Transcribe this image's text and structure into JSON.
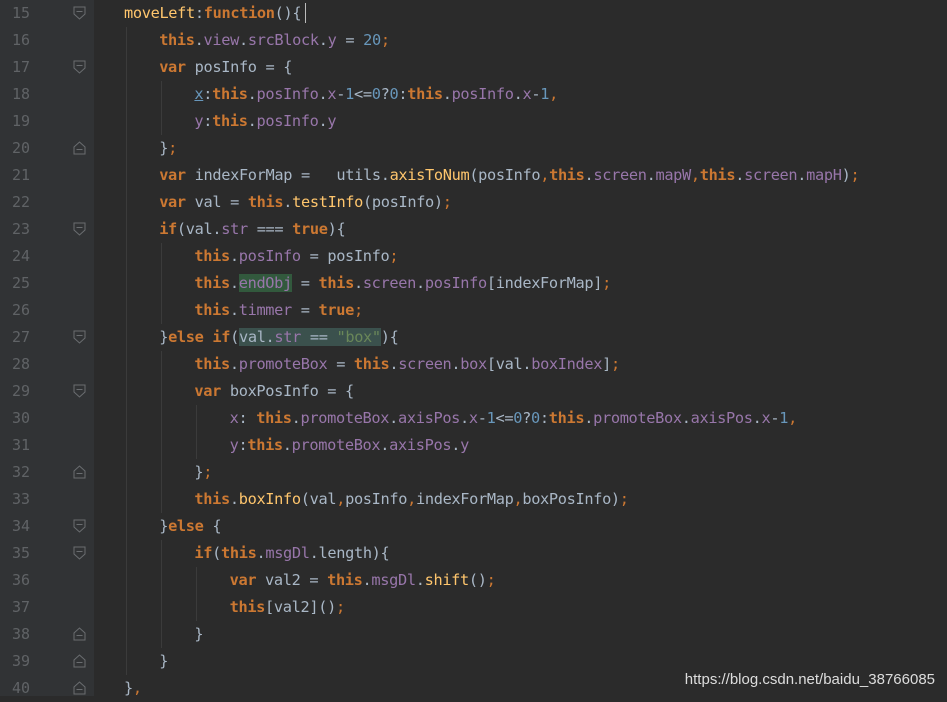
{
  "editor": {
    "watermark": "https://blog.csdn.net/baidu_38766085",
    "lines": [
      {
        "num": "15",
        "tokens": [
          [
            "fn",
            "moveLeft"
          ],
          [
            "plain",
            ":"
          ],
          [
            "kw",
            "function"
          ],
          [
            "plain",
            "()"
          ],
          [
            "plain",
            "{"
          ]
        ]
      },
      {
        "num": "16",
        "tokens": [
          [
            "kw",
            "this"
          ],
          [
            "plain",
            "."
          ],
          [
            "prop",
            "view"
          ],
          [
            "plain",
            "."
          ],
          [
            "prop",
            "srcBlock"
          ],
          [
            "plain",
            "."
          ],
          [
            "prop",
            "y"
          ],
          [
            "plain",
            " = "
          ],
          [
            "num",
            "20"
          ],
          [
            "punct",
            ";"
          ]
        ]
      },
      {
        "num": "17",
        "tokens": [
          [
            "kw",
            "var"
          ],
          [
            "plain",
            " posInfo = {"
          ]
        ]
      },
      {
        "num": "18",
        "tokens": [
          [
            "u",
            "x"
          ],
          [
            "plain",
            ":"
          ],
          [
            "kw",
            "this"
          ],
          [
            "plain",
            "."
          ],
          [
            "prop",
            "posInfo"
          ],
          [
            "plain",
            "."
          ],
          [
            "prop",
            "x"
          ],
          [
            "plain",
            "-"
          ],
          [
            "num",
            "1"
          ],
          [
            "plain",
            "<="
          ],
          [
            "num",
            "0"
          ],
          [
            "plain",
            "?"
          ],
          [
            "num",
            "0"
          ],
          [
            "plain",
            ":"
          ],
          [
            "kw",
            "this"
          ],
          [
            "plain",
            "."
          ],
          [
            "prop",
            "posInfo"
          ],
          [
            "plain",
            "."
          ],
          [
            "prop",
            "x"
          ],
          [
            "plain",
            "-"
          ],
          [
            "num",
            "1"
          ],
          [
            "punct",
            ","
          ]
        ]
      },
      {
        "num": "19",
        "tokens": [
          [
            "prop",
            "y"
          ],
          [
            "plain",
            ":"
          ],
          [
            "kw",
            "this"
          ],
          [
            "plain",
            "."
          ],
          [
            "prop",
            "posInfo"
          ],
          [
            "plain",
            "."
          ],
          [
            "prop",
            "y"
          ]
        ]
      },
      {
        "num": "20",
        "tokens": [
          [
            "plain",
            "}"
          ],
          [
            "punct",
            ";"
          ]
        ]
      },
      {
        "num": "21",
        "tokens": [
          [
            "kw",
            "var"
          ],
          [
            "plain",
            " indexForMap =   utils."
          ],
          [
            "fn",
            "axisToNum"
          ],
          [
            "plain",
            "(posInfo"
          ],
          [
            "punct",
            ","
          ],
          [
            "kw",
            "this"
          ],
          [
            "plain",
            "."
          ],
          [
            "prop",
            "screen"
          ],
          [
            "plain",
            "."
          ],
          [
            "prop",
            "mapW"
          ],
          [
            "punct",
            ","
          ],
          [
            "kw",
            "this"
          ],
          [
            "plain",
            "."
          ],
          [
            "prop",
            "screen"
          ],
          [
            "plain",
            "."
          ],
          [
            "prop",
            "mapH"
          ],
          [
            "plain",
            ")"
          ],
          [
            "punct",
            ";"
          ]
        ]
      },
      {
        "num": "22",
        "tokens": [
          [
            "kw",
            "var"
          ],
          [
            "plain",
            " val = "
          ],
          [
            "kw",
            "this"
          ],
          [
            "plain",
            "."
          ],
          [
            "fn",
            "testInfo"
          ],
          [
            "plain",
            "(posInfo)"
          ],
          [
            "punct",
            ";"
          ]
        ]
      },
      {
        "num": "23",
        "tokens": [
          [
            "kw",
            "if"
          ],
          [
            "plain",
            "(val."
          ],
          [
            "prop",
            "str"
          ],
          [
            "plain",
            " === "
          ],
          [
            "kw",
            "true"
          ],
          [
            "plain",
            "){"
          ]
        ]
      },
      {
        "num": "24",
        "tokens": [
          [
            "kw",
            "this"
          ],
          [
            "plain",
            "."
          ],
          [
            "prop",
            "posInfo"
          ],
          [
            "plain",
            " = posInfo"
          ],
          [
            "punct",
            ";"
          ]
        ]
      },
      {
        "num": "25",
        "tokens": [
          [
            "kw",
            "this"
          ],
          [
            "plain",
            "."
          ],
          [
            "hl",
            "endObj"
          ],
          [
            "plain",
            " = "
          ],
          [
            "kw",
            "this"
          ],
          [
            "plain",
            "."
          ],
          [
            "prop",
            "screen"
          ],
          [
            "plain",
            "."
          ],
          [
            "prop",
            "posInfo"
          ],
          [
            "plain",
            "[indexForMap]"
          ],
          [
            "punct",
            ";"
          ]
        ]
      },
      {
        "num": "26",
        "tokens": [
          [
            "kw",
            "this"
          ],
          [
            "plain",
            "."
          ],
          [
            "prop",
            "timmer"
          ],
          [
            "plain",
            " = "
          ],
          [
            "kw",
            "true"
          ],
          [
            "punct",
            ";"
          ]
        ]
      },
      {
        "num": "27",
        "tokens": [
          [
            "plain",
            "}"
          ],
          [
            "kw",
            "else if"
          ],
          [
            "plain",
            "("
          ],
          [
            "m1",
            "val."
          ],
          [
            "m2",
            "str"
          ],
          [
            "m1",
            " == "
          ],
          [
            "m3",
            "\"box\""
          ],
          [
            "plain",
            "){"
          ]
        ]
      },
      {
        "num": "28",
        "tokens": [
          [
            "kw",
            "this"
          ],
          [
            "plain",
            "."
          ],
          [
            "prop",
            "promoteBox"
          ],
          [
            "plain",
            " = "
          ],
          [
            "kw",
            "this"
          ],
          [
            "plain",
            "."
          ],
          [
            "prop",
            "screen"
          ],
          [
            "plain",
            "."
          ],
          [
            "prop",
            "box"
          ],
          [
            "plain",
            "[val."
          ],
          [
            "prop",
            "boxIndex"
          ],
          [
            "plain",
            "]"
          ],
          [
            "punct",
            ";"
          ]
        ]
      },
      {
        "num": "29",
        "tokens": [
          [
            "kw",
            "var"
          ],
          [
            "plain",
            " boxPosInfo = {"
          ]
        ]
      },
      {
        "num": "30",
        "tokens": [
          [
            "prop",
            "x"
          ],
          [
            "plain",
            ": "
          ],
          [
            "kw",
            "this"
          ],
          [
            "plain",
            "."
          ],
          [
            "prop",
            "promoteBox"
          ],
          [
            "plain",
            "."
          ],
          [
            "prop",
            "axisPos"
          ],
          [
            "plain",
            "."
          ],
          [
            "prop",
            "x"
          ],
          [
            "plain",
            "-"
          ],
          [
            "num",
            "1"
          ],
          [
            "plain",
            "<="
          ],
          [
            "num",
            "0"
          ],
          [
            "plain",
            "?"
          ],
          [
            "num",
            "0"
          ],
          [
            "plain",
            ":"
          ],
          [
            "kw",
            "this"
          ],
          [
            "plain",
            "."
          ],
          [
            "prop",
            "promoteBox"
          ],
          [
            "plain",
            "."
          ],
          [
            "prop",
            "axisPos"
          ],
          [
            "plain",
            "."
          ],
          [
            "prop",
            "x"
          ],
          [
            "plain",
            "-"
          ],
          [
            "num",
            "1"
          ],
          [
            "punct",
            ","
          ]
        ]
      },
      {
        "num": "31",
        "tokens": [
          [
            "prop",
            "y"
          ],
          [
            "plain",
            ":"
          ],
          [
            "kw",
            "this"
          ],
          [
            "plain",
            "."
          ],
          [
            "prop",
            "promoteBox"
          ],
          [
            "plain",
            "."
          ],
          [
            "prop",
            "axisPos"
          ],
          [
            "plain",
            "."
          ],
          [
            "prop",
            "y"
          ]
        ]
      },
      {
        "num": "32",
        "tokens": [
          [
            "plain",
            "}"
          ],
          [
            "punct",
            ";"
          ]
        ]
      },
      {
        "num": "33",
        "tokens": [
          [
            "kw",
            "this"
          ],
          [
            "plain",
            "."
          ],
          [
            "fn",
            "boxInfo"
          ],
          [
            "plain",
            "(val"
          ],
          [
            "punct",
            ","
          ],
          [
            "plain",
            "posInfo"
          ],
          [
            "punct",
            ","
          ],
          [
            "plain",
            "indexForMap"
          ],
          [
            "punct",
            ","
          ],
          [
            "plain",
            "boxPosInfo)"
          ],
          [
            "punct",
            ";"
          ]
        ]
      },
      {
        "num": "34",
        "tokens": [
          [
            "plain",
            "}"
          ],
          [
            "kw",
            "else "
          ],
          [
            "plain",
            "{"
          ]
        ]
      },
      {
        "num": "35",
        "tokens": [
          [
            "kw",
            "if"
          ],
          [
            "plain",
            "("
          ],
          [
            "kw",
            "this"
          ],
          [
            "plain",
            "."
          ],
          [
            "prop",
            "msgDl"
          ],
          [
            "plain",
            "."
          ],
          [
            "plain",
            "length){"
          ]
        ]
      },
      {
        "num": "36",
        "tokens": [
          [
            "kw",
            "var"
          ],
          [
            "plain",
            " val2 = "
          ],
          [
            "kw",
            "this"
          ],
          [
            "plain",
            "."
          ],
          [
            "prop",
            "msgDl"
          ],
          [
            "plain",
            "."
          ],
          [
            "fn",
            "shift"
          ],
          [
            "plain",
            "()"
          ],
          [
            "punct",
            ";"
          ]
        ]
      },
      {
        "num": "37",
        "tokens": [
          [
            "kw",
            "this"
          ],
          [
            "plain",
            "[val2]()"
          ],
          [
            "punct",
            ";"
          ]
        ]
      },
      {
        "num": "38",
        "tokens": [
          [
            "plain",
            "}"
          ]
        ]
      },
      {
        "num": "39",
        "tokens": [
          [
            "plain",
            "}"
          ]
        ]
      },
      {
        "num": "40",
        "tokens": [
          [
            "plain",
            "}"
          ],
          [
            "punct",
            ","
          ]
        ]
      }
    ]
  }
}
